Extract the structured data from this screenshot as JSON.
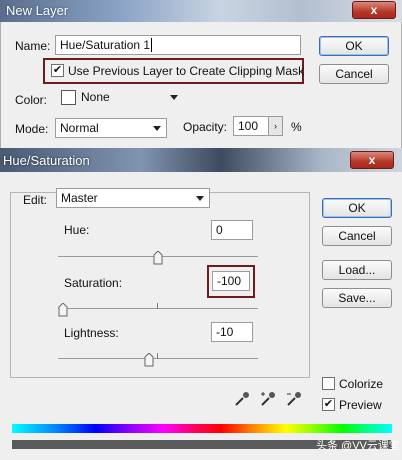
{
  "new_layer": {
    "title": "New Layer",
    "name_label": "Name:",
    "name_value": "Hue/Saturation 1",
    "clip_label": "Use Previous Layer to Create Clipping Mask",
    "clip_checked": "✔",
    "color_label": "Color:",
    "color_value": "None",
    "mode_label": "Mode:",
    "mode_value": "Normal",
    "opacity_label": "Opacity:",
    "opacity_value": "100",
    "opacity_unit": "%",
    "ok": "OK",
    "cancel": "Cancel",
    "close": "x"
  },
  "hue_sat": {
    "title": "Hue/Saturation",
    "close": "x",
    "edit_label": "Edit:",
    "edit_value": "Master",
    "hue_label": "Hue:",
    "hue_value": "0",
    "saturation_label": "Saturation:",
    "saturation_value": "-100",
    "lightness_label": "Lightness:",
    "lightness_value": "-10",
    "ok": "OK",
    "cancel": "Cancel",
    "load": "Load...",
    "save": "Save...",
    "colorize_label": "Colorize",
    "preview_label": "Preview",
    "preview_checked": "✔",
    "colorize_checked": ""
  },
  "sliders": {
    "hue_level": 0.5,
    "saturation_level": 0.0,
    "lightness_level": 0.45
  },
  "watermark": "头条 @VV云课堂",
  "colors": {
    "highlight": "#6b1d1d",
    "close_button": "#b7372a",
    "dialog_bg": "#efefef"
  }
}
